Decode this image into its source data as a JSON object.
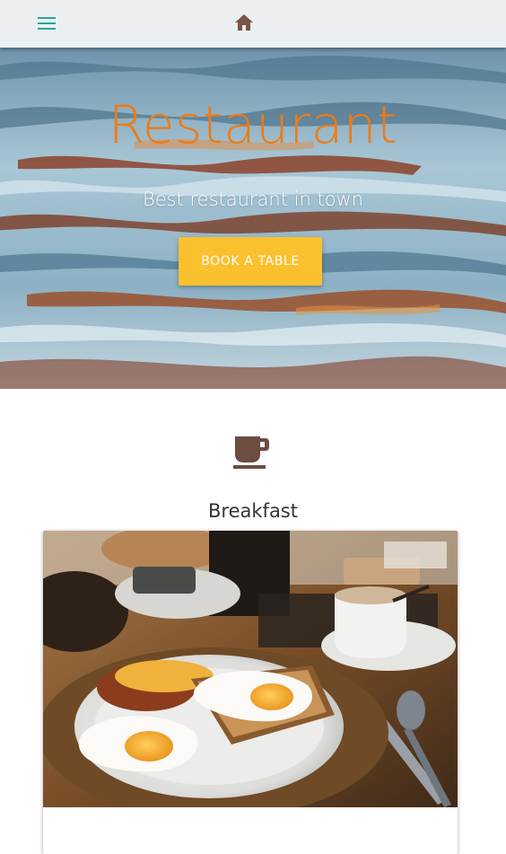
{
  "appbar": {
    "menu_icon": "hamburger-menu-icon",
    "home_icon": "home-icon"
  },
  "hero": {
    "title": "Restaurant",
    "subtitle": "Best restaurant in town",
    "button_label": "BOOK A TABLE",
    "colors": {
      "title": "#f07a12",
      "button": "#fbc02d"
    }
  },
  "section": {
    "icon": "coffee-cup-icon",
    "title": "Breakfast"
  },
  "colors": {
    "appbar_bg": "#eceff1",
    "menu_icon": "#26a69a",
    "home_icon": "#795548",
    "coffee_icon": "#6d4c41"
  }
}
